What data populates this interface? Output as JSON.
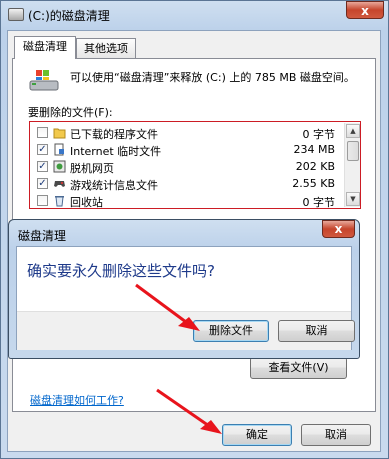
{
  "main_window": {
    "title": "(C:)的磁盘清理",
    "close_glyph": "x",
    "tabs": [
      "磁盘清理",
      "其他选项"
    ],
    "info": "可以使用“磁盘清理”来释放  (C:) 上的 785 MB 磁盘空间。",
    "files_label": "要删除的文件(F):",
    "files": [
      {
        "name": "已下载的程序文件",
        "size": "0 字节",
        "checked": false,
        "icon": "folder-icon"
      },
      {
        "name": "Internet 临时文件",
        "size": "234 MB",
        "checked": true,
        "icon": "document-lock-icon"
      },
      {
        "name": "脱机网页",
        "size": "202 KB",
        "checked": true,
        "icon": "offline-page-icon"
      },
      {
        "name": "游戏统计信息文件",
        "size": "2.55 KB",
        "checked": true,
        "icon": "game-controller-icon"
      },
      {
        "name": "回收站",
        "size": "0 字节",
        "checked": false,
        "icon": "recycle-bin-icon"
      }
    ],
    "view_files_button": "查看文件(V)",
    "help_link": "磁盘清理如何工作?",
    "ok_button": "确定",
    "cancel_button": "取消"
  },
  "dialog": {
    "title": "磁盘清理",
    "close_glyph": "x",
    "message": "确实要永久删除这些文件吗?",
    "delete_button": "删除文件",
    "cancel_button": "取消"
  },
  "colors": {
    "link": "#0066cc",
    "highlight_border": "#cc1c24",
    "arrow": "#e8141c"
  }
}
